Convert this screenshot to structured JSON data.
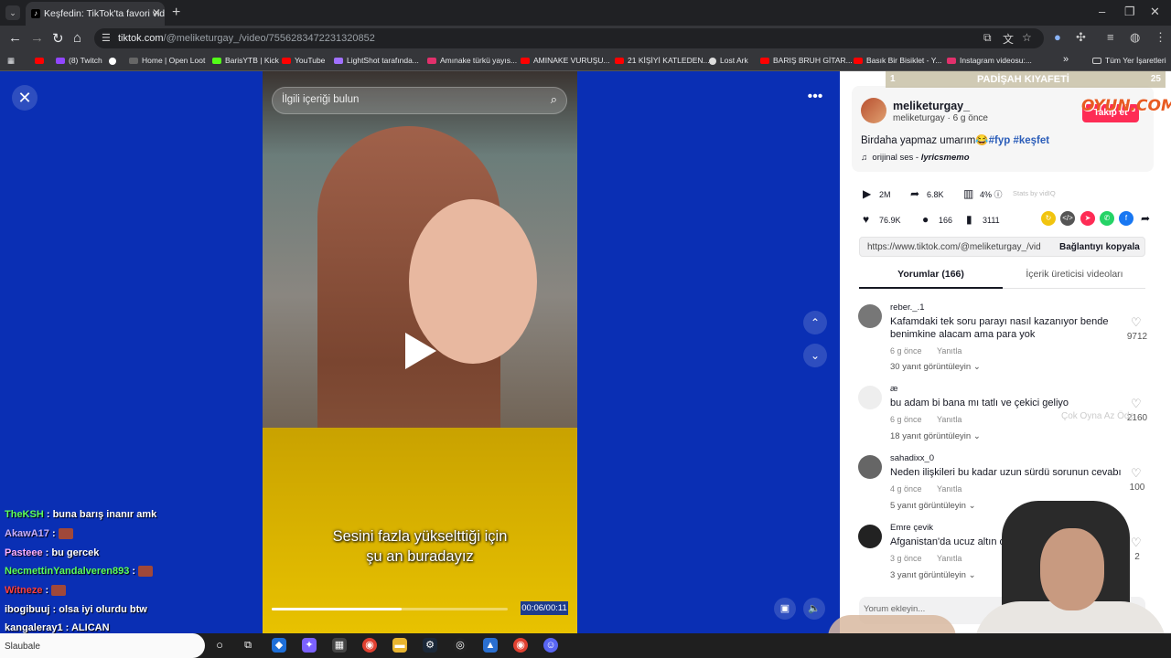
{
  "browser": {
    "tab_title": "Keşfedin: TikTok'ta favori videoları",
    "url_host": "tiktok.com",
    "url_path": "/@meliketurgay_/video/7556283472231320852",
    "bookmarks": [
      {
        "label": "",
        "color": "#ff0000"
      },
      {
        "label": "(8) Twitch",
        "color": "#9146ff"
      },
      {
        "label": "",
        "color": "#fff"
      },
      {
        "label": "Home | Open Loot",
        "color": "#333"
      },
      {
        "label": "BarisYTB | Kick",
        "color": "#53fc18"
      },
      {
        "label": "YouTube",
        "color": "#ff0000"
      },
      {
        "label": "LightShot tarafında...",
        "color": "#a070ff"
      },
      {
        "label": "Amınake türkü yayıs...",
        "color": "#e1306c"
      },
      {
        "label": "AMINAKE VURUŞU...",
        "color": "#ff0000"
      },
      {
        "label": "21 KİŞİYİ KATLEDEN...",
        "color": "#ff0000"
      },
      {
        "label": "Lost Ark",
        "color": "#ddd"
      },
      {
        "label": "BARIŞ BRUH GİTAR...",
        "color": "#ff0000"
      },
      {
        "label": "Basık Bir Bisiklet - Y...",
        "color": "#ff0000"
      },
      {
        "label": "Instagram videosu:...",
        "color": "#e1306c"
      }
    ],
    "bookmarks_more": "»",
    "all_bookmarks": "Tüm Yer İşaretleri"
  },
  "video": {
    "search_placeholder": "İlgili içeriği bulun",
    "caption_line1": "Sesini fazla yükselttiği için",
    "caption_line2": "şu an buradayız",
    "timecode": "00:06/00:11",
    "progress": 0.55
  },
  "post": {
    "username": "meliketurgay_",
    "handle": "meliketurgay · 6 g önce",
    "follow_label": "Takip et",
    "desc_text": "Birdaha yapmaz umarım😂",
    "tag1": "#fyp",
    "tag2": "#keşfet",
    "music_label": "orijinal ses - ",
    "music_author": "lyricsmemo",
    "plays": "2M",
    "shares": "6.8K",
    "pct": "4%",
    "stats_by": "Stats by vidIQ",
    "likes": "76.9K",
    "comments": "166",
    "saves": "3111",
    "link": "https://www.tiktok.com/@meliketurgay_/vid...",
    "copy_label": "Bağlantıyı kopyala"
  },
  "tabs": {
    "comments": "Yorumlar (166)",
    "creator_videos": "İçerik üreticisi videoları"
  },
  "comments": [
    {
      "user": "reber._.1",
      "text": "Kafamdaki tek soru parayı nasıl kazanıyor bende benimkine alacam ama para yok",
      "age": "6 g önce",
      "reply": "Yanıtla",
      "views": "30 yanıt görüntüleyin",
      "likes": "9712",
      "avatar": "#777"
    },
    {
      "user": "æ",
      "text": "bu adam bi bana mı tatlı ve çekici geliyo",
      "age": "6 g önce",
      "reply": "Yanıtla",
      "views": "18 yanıt görüntüleyin",
      "likes": "2160",
      "avatar": "#eee"
    },
    {
      "user": "sahadixx_0",
      "text": "Neden ilişkileri bu kadar uzun sürdü sorunun cevabı",
      "age": "4 g önce",
      "reply": "Yanıtla",
      "views": "5 yanıt görüntüleyin",
      "likes": "100",
      "avatar": "#666"
    },
    {
      "user": "Emre çevik",
      "text": "Afganistan'da ucuz altın o",
      "age": "3 g önce",
      "reply": "Yanıtla",
      "views": "3 yanıt görüntüleyin",
      "likes": "2",
      "avatar": "#222"
    }
  ],
  "comment_input": "Yorum ekleyin...",
  "stream_overlay": {
    "rank": "1",
    "title": "PADİŞAH KIYAFETİ",
    "count": "25",
    "logo": "OYUN.COM",
    "logo_sub": "Çok Oyna   Az Öde"
  },
  "chat": [
    {
      "user": "TheKSH",
      "msg": "buna barış inanır amk",
      "color": "#5cff5c",
      "emote": false
    },
    {
      "user": "AkawA17",
      "msg": "",
      "color": "#c8b0ff",
      "emote": true
    },
    {
      "user": "Pasteee",
      "msg": "bu gercek",
      "color": "#ffb0ff",
      "emote": false
    },
    {
      "user": "NecmettinYandalveren893",
      "msg": "",
      "color": "#5cff5c",
      "emote": true
    },
    {
      "user": "Witneze",
      "msg": "",
      "color": "#ff4040",
      "emote": true
    },
    {
      "user": "ibogibuuj",
      "msg": "olsa iyi olurdu btw",
      "color": "#ffffff",
      "emote": false
    },
    {
      "user": "kangaleray1",
      "msg": "ALICAN",
      "color": "#ffffff",
      "emote": false
    }
  ],
  "taskbar": {
    "search_text": "Slaubale"
  }
}
